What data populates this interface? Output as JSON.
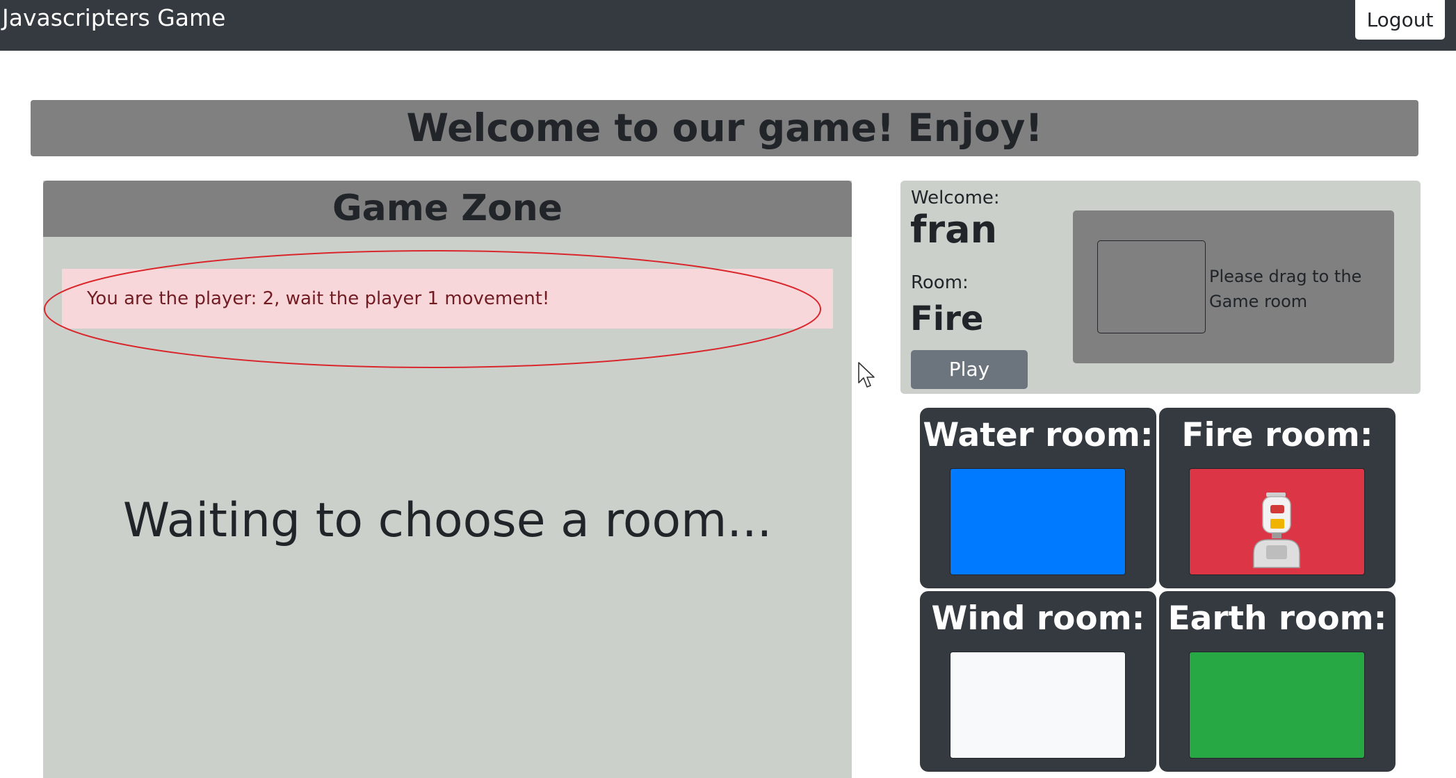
{
  "navbar": {
    "brand": "Javascripters Game",
    "logout_label": "Logout"
  },
  "banner": {
    "title": "Welcome to our game! Enjoy!"
  },
  "game_zone": {
    "title": "Game Zone",
    "alert": "You are the player: 2, wait the player 1 movement!",
    "status": "Waiting to choose a room..."
  },
  "player_info": {
    "welcome_label": "Welcome:",
    "username": "fran",
    "room_label": "Room:",
    "room_name": "Fire",
    "play_label": "Play",
    "drag_hint": "Please drag to the Game room"
  },
  "rooms": [
    {
      "title": "Water room:",
      "color": "#007bff"
    },
    {
      "title": "Fire room:",
      "color": "#dc3545",
      "contains": "robot-avatar"
    },
    {
      "title": "Wind room:",
      "color": "#f8f9fa"
    },
    {
      "title": "Earth room:",
      "color": "#28a745"
    }
  ],
  "colors": {
    "navbar": "#343a40",
    "header_gray": "#808080",
    "panel_bg": "#cbd0cb",
    "alert_bg": "#f8d7da",
    "alert_text": "#721c24",
    "annotation_ellipse": "#d9262b"
  }
}
